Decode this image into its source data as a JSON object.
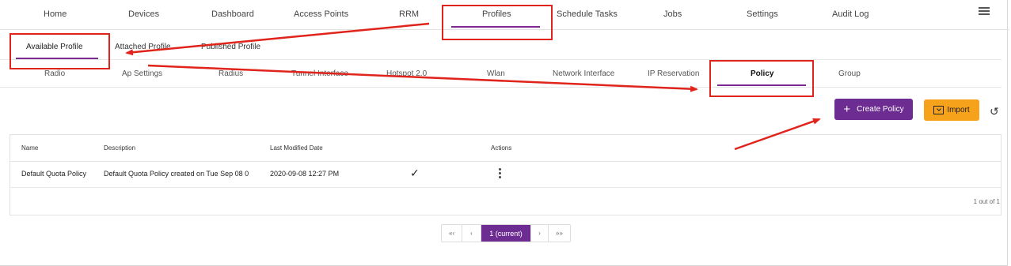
{
  "topnav": {
    "items": [
      "Home",
      "Devices",
      "Dashboard",
      "Access Points",
      "RRM",
      "Profiles",
      "Schedule Tasks",
      "Jobs",
      "Settings",
      "Audit Log"
    ],
    "active": "Profiles"
  },
  "profile_tabs": {
    "items": [
      "Available Profile",
      "Attached Profile",
      "Published Profile"
    ],
    "active": "Available Profile"
  },
  "sub_tabs": {
    "items": [
      "Radio",
      "Ap Settings",
      "Radius",
      "Tunnel Interface",
      "Hotspot 2.0",
      "Wlan",
      "Network Interface",
      "IP Reservation",
      "Policy",
      "Group"
    ],
    "active": "Policy"
  },
  "actions": {
    "create_label": "Create Policy",
    "import_label": "Import"
  },
  "table": {
    "columns": [
      "Name",
      "Description",
      "Last Modified Date",
      "Actions"
    ],
    "rows": [
      {
        "name": "Default Quota Policy",
        "description": "Default Quota Policy created on Tue Sep 08 0",
        "last_modified": "2020-09-08 12:27 PM",
        "default": true
      }
    ],
    "count_text": "1 out of 1"
  },
  "pagination": {
    "first": "«‹",
    "prev": "‹",
    "current": "1 (current)",
    "next": "›",
    "last": "»»"
  },
  "colors": {
    "accent": "#6d2c91",
    "import": "#f7a21b",
    "annotation": "#e0241b"
  }
}
